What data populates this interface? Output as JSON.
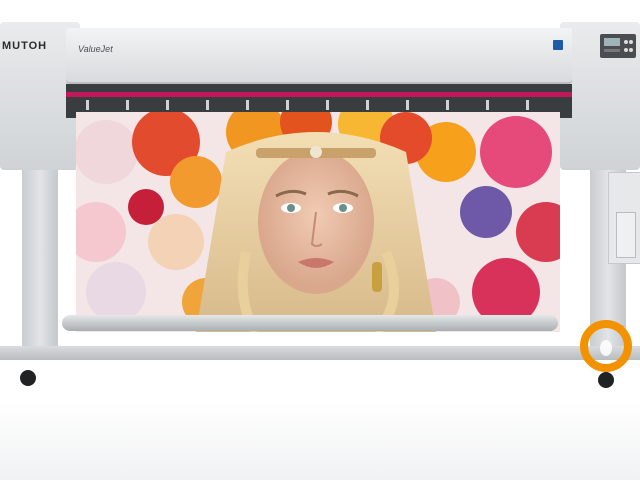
{
  "scene": {
    "description_free": true
  },
  "printer": {
    "brand_label": "MUTOH",
    "model_label": "ValueJet"
  },
  "icons": {
    "watermark": "orange-circle-logo-icon",
    "control_panel": "control-panel-icon"
  },
  "colors": {
    "printer_gray": "#d7dadc",
    "accent_magenta": "#c2185b",
    "watermark_orange": "#f39200"
  }
}
